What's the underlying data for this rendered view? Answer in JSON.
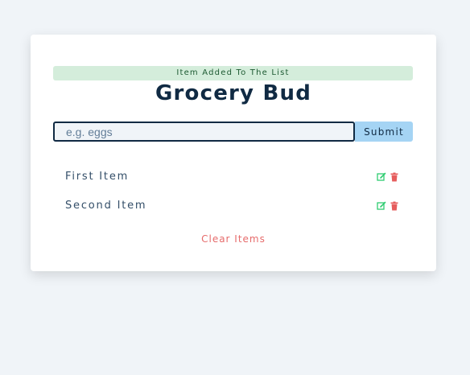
{
  "alert": {
    "text": "Item Added To The List",
    "color": "#d4eddb"
  },
  "header": {
    "title": "Grocery Bud"
  },
  "form": {
    "placeholder": "e.g. eggs",
    "value": "",
    "submit_label": "Submit"
  },
  "list": {
    "items": [
      {
        "label": "First Item",
        "edit_icon": "edit-icon",
        "delete_icon": "trash-icon"
      },
      {
        "label": "Second Item",
        "edit_icon": "edit-icon",
        "delete_icon": "trash-icon"
      }
    ]
  },
  "footer": {
    "clear_label": "Clear Items"
  },
  "colors": {
    "background": "#f0f4f8",
    "primary": "#102a43",
    "submit": "#a5d4f4",
    "edit": "#2ecc71",
    "delete": "#e65d5d",
    "clear": "#e66b6b"
  }
}
